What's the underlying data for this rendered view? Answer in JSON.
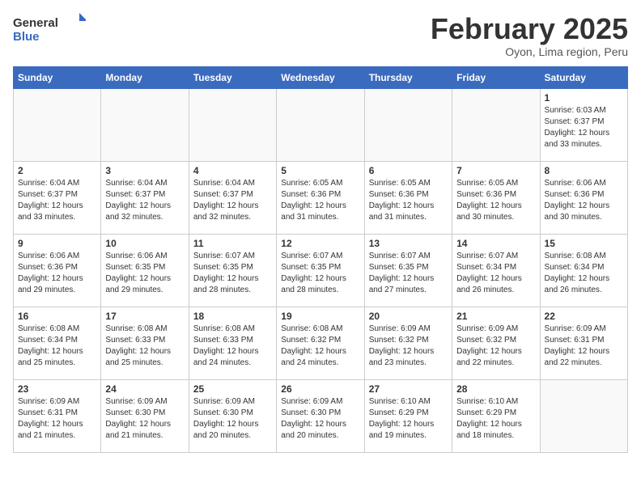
{
  "header": {
    "logo_general": "General",
    "logo_blue": "Blue",
    "title": "February 2025",
    "subtitle": "Oyon, Lima region, Peru"
  },
  "days_of_week": [
    "Sunday",
    "Monday",
    "Tuesday",
    "Wednesday",
    "Thursday",
    "Friday",
    "Saturday"
  ],
  "weeks": [
    [
      {
        "day": "",
        "info": ""
      },
      {
        "day": "",
        "info": ""
      },
      {
        "day": "",
        "info": ""
      },
      {
        "day": "",
        "info": ""
      },
      {
        "day": "",
        "info": ""
      },
      {
        "day": "",
        "info": ""
      },
      {
        "day": "1",
        "info": "Sunrise: 6:03 AM\nSunset: 6:37 PM\nDaylight: 12 hours and 33 minutes."
      }
    ],
    [
      {
        "day": "2",
        "info": "Sunrise: 6:04 AM\nSunset: 6:37 PM\nDaylight: 12 hours and 33 minutes."
      },
      {
        "day": "3",
        "info": "Sunrise: 6:04 AM\nSunset: 6:37 PM\nDaylight: 12 hours and 32 minutes."
      },
      {
        "day": "4",
        "info": "Sunrise: 6:04 AM\nSunset: 6:37 PM\nDaylight: 12 hours and 32 minutes."
      },
      {
        "day": "5",
        "info": "Sunrise: 6:05 AM\nSunset: 6:36 PM\nDaylight: 12 hours and 31 minutes."
      },
      {
        "day": "6",
        "info": "Sunrise: 6:05 AM\nSunset: 6:36 PM\nDaylight: 12 hours and 31 minutes."
      },
      {
        "day": "7",
        "info": "Sunrise: 6:05 AM\nSunset: 6:36 PM\nDaylight: 12 hours and 30 minutes."
      },
      {
        "day": "8",
        "info": "Sunrise: 6:06 AM\nSunset: 6:36 PM\nDaylight: 12 hours and 30 minutes."
      }
    ],
    [
      {
        "day": "9",
        "info": "Sunrise: 6:06 AM\nSunset: 6:36 PM\nDaylight: 12 hours and 29 minutes."
      },
      {
        "day": "10",
        "info": "Sunrise: 6:06 AM\nSunset: 6:35 PM\nDaylight: 12 hours and 29 minutes."
      },
      {
        "day": "11",
        "info": "Sunrise: 6:07 AM\nSunset: 6:35 PM\nDaylight: 12 hours and 28 minutes."
      },
      {
        "day": "12",
        "info": "Sunrise: 6:07 AM\nSunset: 6:35 PM\nDaylight: 12 hours and 28 minutes."
      },
      {
        "day": "13",
        "info": "Sunrise: 6:07 AM\nSunset: 6:35 PM\nDaylight: 12 hours and 27 minutes."
      },
      {
        "day": "14",
        "info": "Sunrise: 6:07 AM\nSunset: 6:34 PM\nDaylight: 12 hours and 26 minutes."
      },
      {
        "day": "15",
        "info": "Sunrise: 6:08 AM\nSunset: 6:34 PM\nDaylight: 12 hours and 26 minutes."
      }
    ],
    [
      {
        "day": "16",
        "info": "Sunrise: 6:08 AM\nSunset: 6:34 PM\nDaylight: 12 hours and 25 minutes."
      },
      {
        "day": "17",
        "info": "Sunrise: 6:08 AM\nSunset: 6:33 PM\nDaylight: 12 hours and 25 minutes."
      },
      {
        "day": "18",
        "info": "Sunrise: 6:08 AM\nSunset: 6:33 PM\nDaylight: 12 hours and 24 minutes."
      },
      {
        "day": "19",
        "info": "Sunrise: 6:08 AM\nSunset: 6:32 PM\nDaylight: 12 hours and 24 minutes."
      },
      {
        "day": "20",
        "info": "Sunrise: 6:09 AM\nSunset: 6:32 PM\nDaylight: 12 hours and 23 minutes."
      },
      {
        "day": "21",
        "info": "Sunrise: 6:09 AM\nSunset: 6:32 PM\nDaylight: 12 hours and 22 minutes."
      },
      {
        "day": "22",
        "info": "Sunrise: 6:09 AM\nSunset: 6:31 PM\nDaylight: 12 hours and 22 minutes."
      }
    ],
    [
      {
        "day": "23",
        "info": "Sunrise: 6:09 AM\nSunset: 6:31 PM\nDaylight: 12 hours and 21 minutes."
      },
      {
        "day": "24",
        "info": "Sunrise: 6:09 AM\nSunset: 6:30 PM\nDaylight: 12 hours and 21 minutes."
      },
      {
        "day": "25",
        "info": "Sunrise: 6:09 AM\nSunset: 6:30 PM\nDaylight: 12 hours and 20 minutes."
      },
      {
        "day": "26",
        "info": "Sunrise: 6:09 AM\nSunset: 6:30 PM\nDaylight: 12 hours and 20 minutes."
      },
      {
        "day": "27",
        "info": "Sunrise: 6:10 AM\nSunset: 6:29 PM\nDaylight: 12 hours and 19 minutes."
      },
      {
        "day": "28",
        "info": "Sunrise: 6:10 AM\nSunset: 6:29 PM\nDaylight: 12 hours and 18 minutes."
      },
      {
        "day": "",
        "info": ""
      }
    ]
  ]
}
